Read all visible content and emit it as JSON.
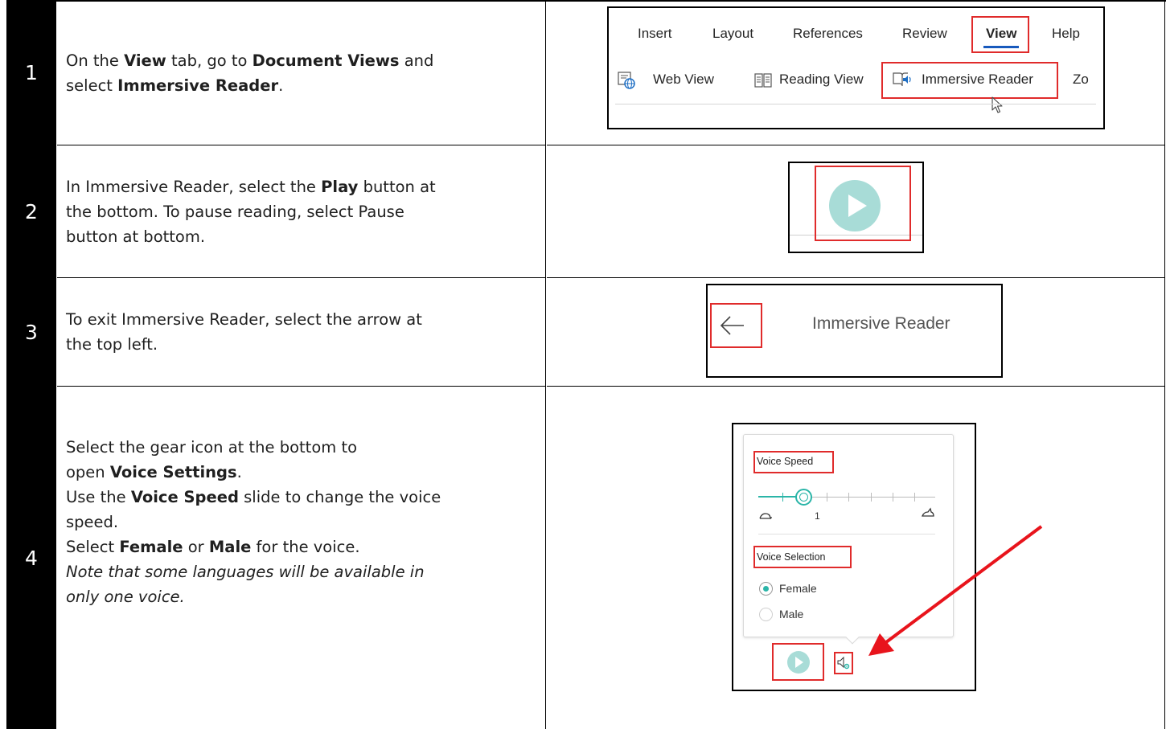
{
  "steps": [
    {
      "number": "1",
      "lines": [
        [
          {
            "t": "On the "
          },
          {
            "t": "View",
            "b": true
          },
          {
            "t": " tab, go to "
          },
          {
            "t": "Document Views",
            "b": true
          },
          {
            "t": " and"
          }
        ],
        [
          {
            "t": "select "
          },
          {
            "t": "Immersive Reader",
            "b": true
          },
          {
            "t": "."
          }
        ]
      ]
    },
    {
      "number": "2",
      "lines": [
        [
          {
            "t": "In Immersive Reader, select the "
          },
          {
            "t": "Play",
            "b": true
          },
          {
            "t": " button at"
          }
        ],
        [
          {
            "t": "the bottom.   To pause reading, select Pause"
          }
        ],
        [
          {
            "t": "button at bottom."
          }
        ]
      ]
    },
    {
      "number": "3",
      "lines": [
        [
          {
            "t": "To exit Immersive Reader, select the arrow at"
          }
        ],
        [
          {
            "t": "the top left."
          }
        ]
      ]
    },
    {
      "number": "4",
      "lines": [
        [
          {
            "t": "Select the gear icon at the bottom to"
          }
        ],
        [
          {
            "t": "open "
          },
          {
            "t": "Voice Settings",
            "b": true
          },
          {
            "t": "."
          }
        ],
        [
          {
            "t": "Use the "
          },
          {
            "t": "Voice Speed",
            "b": true
          },
          {
            "t": " slide to change the voice"
          }
        ],
        [
          {
            "t": "speed."
          }
        ],
        [
          {
            "t": "Select "
          },
          {
            "t": "Female",
            "b": true
          },
          {
            "t": " or "
          },
          {
            "t": "Male",
            "b": true
          },
          {
            "t": " for the voice."
          }
        ],
        [
          {
            "t": "Note that some languages will be available in",
            "i": true
          }
        ],
        [
          {
            "t": "only one voice.",
            "i": true
          }
        ]
      ]
    }
  ],
  "ribbon": {
    "tabs": [
      "Insert",
      "Layout",
      "References",
      "Review",
      "View",
      "Help"
    ],
    "active_tab": "View",
    "items": [
      "Web View",
      "Reading View",
      "Immersive Reader",
      "Zo"
    ]
  },
  "immersive_reader": {
    "title": "Immersive Reader"
  },
  "voice_settings": {
    "speed_label": "Voice Speed",
    "speed_value": "1",
    "selection_label": "Voice Selection",
    "options": [
      "Female",
      "Male"
    ],
    "selected": "Female"
  },
  "colors": {
    "highlight": "#e02b2b",
    "play": "#a8dcd7",
    "accent": "#2bb5a8"
  }
}
